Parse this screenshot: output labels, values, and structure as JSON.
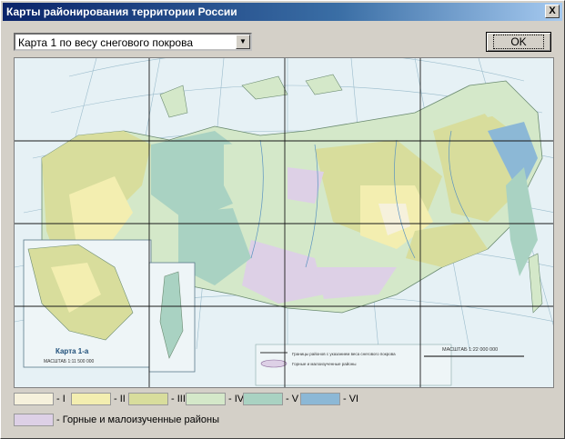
{
  "window": {
    "title": "Карты районирования территории России",
    "close_label": "X"
  },
  "selector": {
    "value": "Карта 1 по весу снегового покрова"
  },
  "ok_button": {
    "label": "OK"
  },
  "map": {
    "inset_title": "Карта 1-а",
    "inset_scale": "МАСШТАБ 1:11 500 000",
    "main_scale": "МАСШТАБ 1:22 000 000",
    "legend_note_1": "Границы районов с указанием веса снегового покрова",
    "legend_note_2": "Горные и малоизученные районы"
  },
  "legend": {
    "items": [
      {
        "label": "- I",
        "color": "#f6f1dc"
      },
      {
        "label": "- II",
        "color": "#f3eeb0"
      },
      {
        "label": "- III",
        "color": "#d8dd9c"
      },
      {
        "label": "- IV",
        "color": "#d4e8c9"
      },
      {
        "label": "- V",
        "color": "#a9d2c2"
      },
      {
        "label": "- VI",
        "color": "#8cb8d6"
      }
    ],
    "mountain": {
      "label": "- Горные и малоизученные районы",
      "color": "#ddd0e6"
    }
  }
}
